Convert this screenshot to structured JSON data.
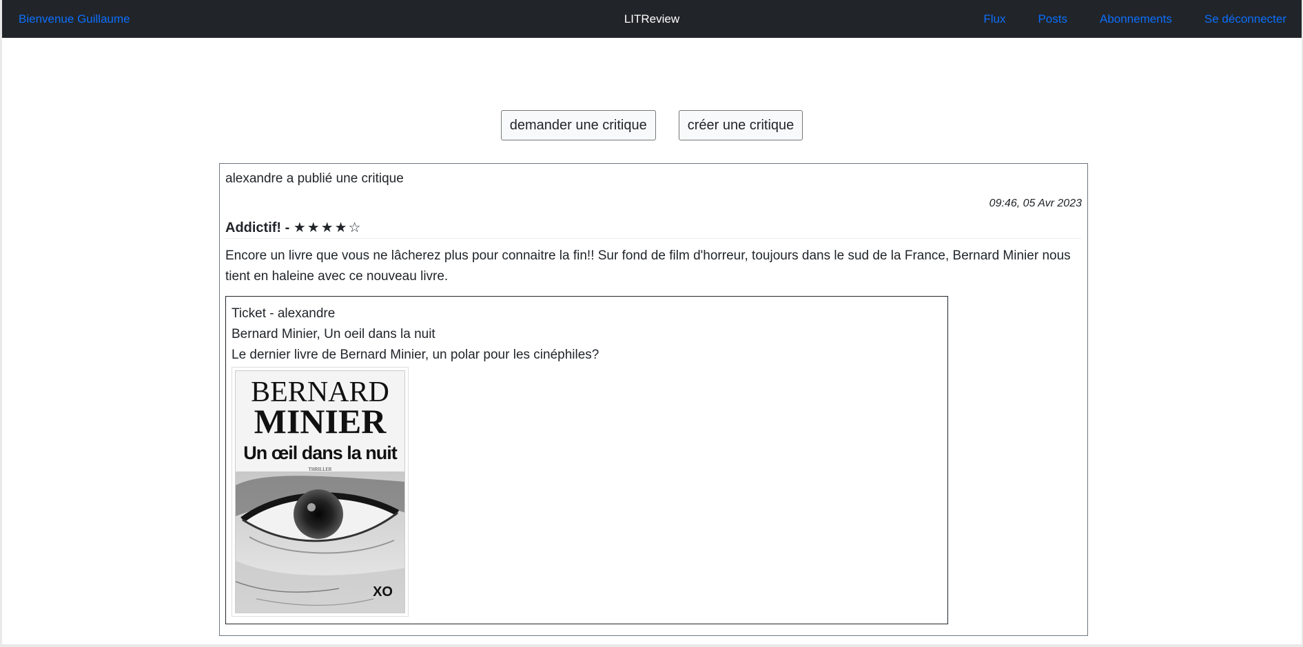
{
  "navbar": {
    "welcome": "Bienvenue Guillaume",
    "brand": "LITReview",
    "links": [
      "Flux",
      "Posts",
      "Abonnements",
      "Se déconnecter"
    ]
  },
  "actions": {
    "request_review": "demander une critique",
    "create_review": "créer une critique"
  },
  "post": {
    "header": "alexandre a publié une critique",
    "timestamp": "09:46, 05 Avr 2023",
    "review_title": "Addictif! - ",
    "rating_stars": "★★★★☆",
    "rating_value": 4,
    "rating_max": 5,
    "body": "Encore un livre que vous ne lâcherez plus pour connaitre la fin!! Sur fond de film d'horreur, toujours dans le sud de la France, Bernard Minier nous tient en haleine avec ce nouveau livre.",
    "ticket": {
      "header": "Ticket - alexandre",
      "book": "Bernard Minier, Un oeil dans la nuit",
      "description": "Le dernier livre de Bernard Minier, un polar pour les cinéphiles?",
      "cover": {
        "author_first": "BERNARD",
        "author_last": "MINIER",
        "title": "Un œil dans la nuit",
        "genre": "THRILLER",
        "publisher": "XO"
      }
    }
  },
  "colors": {
    "navbar_bg": "#212529",
    "link": "#0d6efd",
    "text": "#212529"
  }
}
